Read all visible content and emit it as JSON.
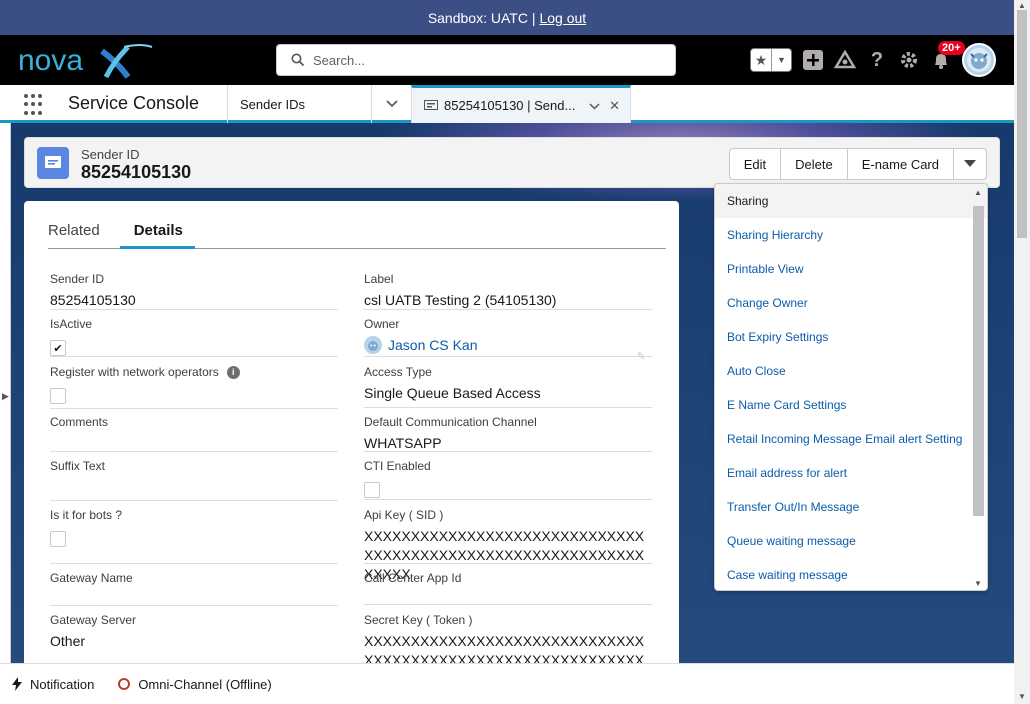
{
  "sandbox": {
    "text": "Sandbox: UATC |",
    "logout_label": "Log out"
  },
  "header": {
    "logo_text": "nova",
    "search_placeholder": "Search...",
    "notif_count": "20+"
  },
  "nav": {
    "app_name": "Service Console",
    "object_tab": "Sender IDs",
    "record_tab": "85254105130 | Send..."
  },
  "record": {
    "type": "Sender ID",
    "name": "85254105130",
    "actions": [
      "Edit",
      "Delete",
      "E-name Card"
    ]
  },
  "tabs": {
    "related": "Related",
    "details": "Details"
  },
  "fields": {
    "sender_id": {
      "label": "Sender ID",
      "value": "85254105130"
    },
    "label": {
      "label": "Label",
      "value": "csl UATB Testing 2 (54105130)"
    },
    "is_active": {
      "label": "IsActive",
      "checked": true
    },
    "owner": {
      "label": "Owner",
      "value": "Jason CS Kan"
    },
    "register": {
      "label": "Register with network operators"
    },
    "access_type": {
      "label": "Access Type",
      "value": "Single Queue Based Access"
    },
    "comments": {
      "label": "Comments",
      "value": ""
    },
    "default_channel": {
      "label": "Default Communication Channel",
      "value": "WHATSAPP"
    },
    "suffix_text": {
      "label": "Suffix Text",
      "value": ""
    },
    "cti_enabled": {
      "label": "CTI Enabled"
    },
    "for_bots": {
      "label": "Is it for bots ?"
    },
    "api_key": {
      "label": "Api Key ( SID )",
      "value": "XXXXXXXXXXXXXXXXXXXXXXXXXXXXXXXXXXXXXXXXXXXXXXXXXXXXXXXXXXXXXXXXX"
    },
    "gateway_name": {
      "label": "Gateway Name",
      "value": ""
    },
    "call_center_app_id": {
      "label": "Call Center App Id",
      "value": ""
    },
    "gateway_server": {
      "label": "Gateway Server",
      "value": "Other"
    },
    "secret_key": {
      "label": "Secret Key ( Token )",
      "value": "XXXXXXXXXXXXXXXXXXXXXXXXXXXXXXXXXXXXXXXXXXXXXXXXXXXXXXXXXXXXXXXXX"
    }
  },
  "menu": [
    "Sharing",
    "Sharing Hierarchy",
    "Printable View",
    "Change Owner",
    "Bot Expiry Settings",
    "Auto Close",
    "E Name Card Settings",
    "Retail Incoming Message Email alert Setting",
    "Email address for alert",
    "Transfer Out/In Message",
    "Queue waiting message",
    "Case waiting message"
  ],
  "utility": {
    "notification": "Notification",
    "omni": "Omni-Channel (Offline)"
  },
  "colors": {
    "accent": "#1b96c9",
    "link": "#0b5cab",
    "sandbox_bar": "#3c4f84"
  }
}
